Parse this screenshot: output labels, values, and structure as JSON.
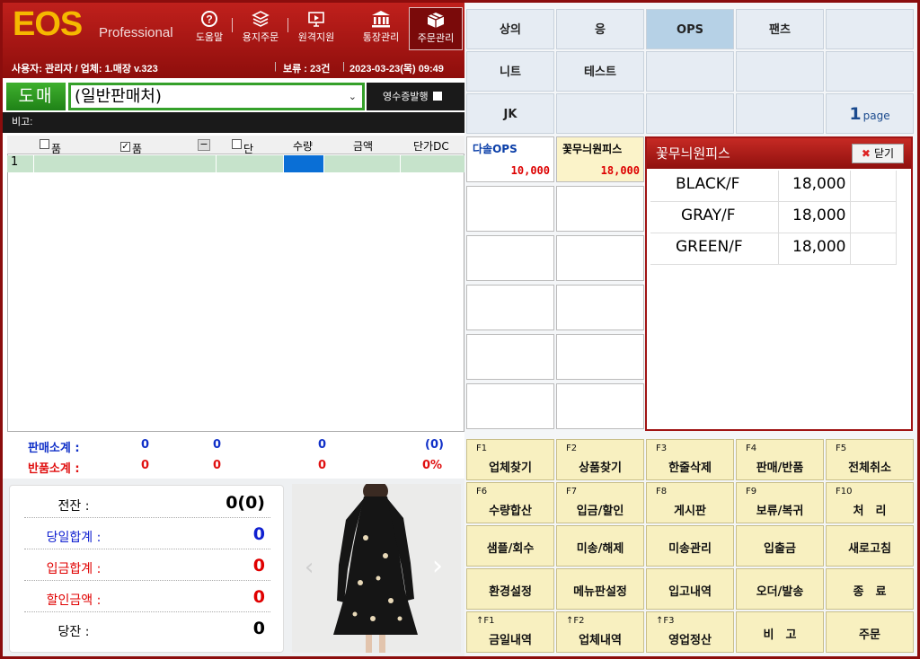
{
  "header": {
    "logo": "EOS",
    "logo_sub": "Professional",
    "toolbar": [
      {
        "label": "도움말",
        "icon": "help-icon"
      },
      {
        "label": "용지주문",
        "icon": "layers-icon"
      },
      {
        "label": "원격지원",
        "icon": "monitor-icon"
      },
      {
        "label": "통장관리",
        "icon": "bank-icon"
      },
      {
        "label": "주문관리",
        "icon": "box-icon",
        "active": true
      }
    ],
    "user_info": "사용자: 관리자 / 업체: 1.매장 v.323",
    "hold": "보류 : 23건",
    "datetime": "2023-03-23(목) 09:49"
  },
  "sale": {
    "mode_button": "도매",
    "customer": "(일반판매처)",
    "receipt_label": "영수증발행",
    "memo_label": "비고:"
  },
  "table": {
    "headers": {
      "item_no": "품번",
      "item_name": "품명",
      "collapse": "−",
      "unit_price": "단가",
      "qty": "수량",
      "amount": "금액",
      "dc": "단가DC"
    },
    "rows": [
      {
        "no": "1"
      }
    ]
  },
  "summary": {
    "sales_label": "판매소계 :",
    "sales": [
      "0",
      "0",
      "0",
      "(0)"
    ],
    "return_label": "반품소계 :",
    "returns": [
      "0",
      "0",
      "0",
      "0%"
    ]
  },
  "balance": [
    {
      "label": "전잔 :",
      "value": "0(0)",
      "color": "#000000"
    },
    {
      "label": "당일합계 :",
      "value": "0",
      "color": "#1020d0"
    },
    {
      "label": "입금합계 :",
      "value": "0",
      "color": "#e00000"
    },
    {
      "label": "할인금액 :",
      "value": "0",
      "color": "#e00000"
    },
    {
      "label": "당잔 :",
      "value": "0",
      "color": "#000000"
    }
  ],
  "categories": [
    "상의",
    "응",
    "OPS",
    "팬츠",
    "",
    "니트",
    "테스트",
    "",
    "",
    "",
    "JK",
    "",
    "",
    "",
    ""
  ],
  "page": {
    "num": "1",
    "label": "page"
  },
  "products": [
    {
      "name": "다솔OPS",
      "price": "10,000"
    },
    {
      "name": "꽃무늬원피스",
      "price": "18,000"
    }
  ],
  "detail": {
    "title": "꽃무늬원피스",
    "close": "닫기",
    "variants": [
      {
        "name": "BLACK/F",
        "price": "18,000"
      },
      {
        "name": "GRAY/F",
        "price": "18,000"
      },
      {
        "name": "GREEN/F",
        "price": "18,000"
      }
    ]
  },
  "fkeys": [
    {
      "k": "F1",
      "t": "업체찾기"
    },
    {
      "k": "F2",
      "t": "상품찾기"
    },
    {
      "k": "F3",
      "t": "한줄삭제"
    },
    {
      "k": "F4",
      "t": "판매/반품"
    },
    {
      "k": "F5",
      "t": "전체취소"
    },
    {
      "k": "F6",
      "t": "수량합산"
    },
    {
      "k": "F7",
      "t": "입금/할인"
    },
    {
      "k": "F8",
      "t": "게시판"
    },
    {
      "k": "F9",
      "t": "보류/복귀"
    },
    {
      "k": "F10",
      "t": "처　리"
    },
    {
      "k": "",
      "t": "샘플/회수"
    },
    {
      "k": "",
      "t": "미송/해제"
    },
    {
      "k": "",
      "t": "미송관리"
    },
    {
      "k": "",
      "t": "입출금"
    },
    {
      "k": "",
      "t": "새로고침"
    },
    {
      "k": "",
      "t": "환경설정"
    },
    {
      "k": "",
      "t": "메뉴판설정"
    },
    {
      "k": "",
      "t": "입고내역"
    },
    {
      "k": "",
      "t": "오더/발송"
    },
    {
      "k": "",
      "t": "종　료"
    },
    {
      "k": "↑F1",
      "t": "금일내역"
    },
    {
      "k": "↑F2",
      "t": "업체내역"
    },
    {
      "k": "↑F3",
      "t": "영업정산"
    },
    {
      "k": "",
      "t": "비　고"
    },
    {
      "k": "",
      "t": "주문"
    }
  ]
}
